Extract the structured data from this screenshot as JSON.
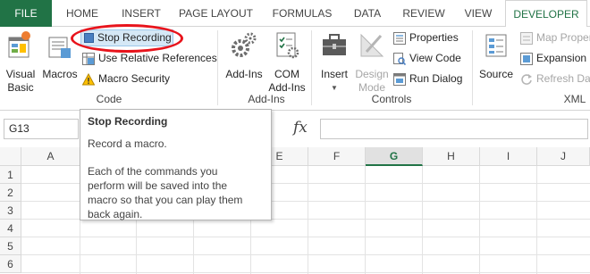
{
  "tabs": [
    {
      "label": "FILE"
    },
    {
      "label": "HOME"
    },
    {
      "label": "INSERT"
    },
    {
      "label": "PAGE LAYOUT"
    },
    {
      "label": "FORMULAS"
    },
    {
      "label": "DATA"
    },
    {
      "label": "REVIEW"
    },
    {
      "label": "VIEW"
    },
    {
      "label": "DEVELOPER"
    }
  ],
  "ribbon": {
    "code": {
      "label": "Code",
      "visual_basic": "Visual\nBasic",
      "macros": "Macros",
      "stop_recording": "Stop Recording",
      "use_relative": "Use Relative References",
      "macro_security": "Macro Security"
    },
    "addins": {
      "label": "Add-Ins",
      "addins_btn": "Add-Ins",
      "com_addins": "COM\nAdd-Ins"
    },
    "controls": {
      "label": "Controls",
      "insert": "Insert",
      "design_mode": "Design\nMode",
      "properties": "Properties",
      "view_code": "View Code",
      "run_dialog": "Run Dialog"
    },
    "xml": {
      "label": "XML",
      "source": "Source",
      "map_properties": "Map Proper",
      "expansion_packs": "Expansion P",
      "refresh_data": "Refresh Data"
    }
  },
  "formula_bar": {
    "name_box": "G13",
    "fx": "fx"
  },
  "grid": {
    "columns": [
      "A",
      "B",
      "C",
      "D",
      "E",
      "F",
      "G",
      "H",
      "I",
      "J"
    ],
    "rows": [
      "1",
      "2",
      "3",
      "4",
      "5",
      "6"
    ],
    "selected_column": "G"
  },
  "tooltip": {
    "title": "Stop Recording",
    "line1": "Record a macro.",
    "desc_lines": [
      "Each of the commands you",
      "perform will be saved into the",
      "macro so that you can play them",
      "back again."
    ]
  },
  "colors": {
    "excel_green": "#217346",
    "annotation_red": "#e8141c",
    "hover_blue": "#d5e8f6"
  }
}
